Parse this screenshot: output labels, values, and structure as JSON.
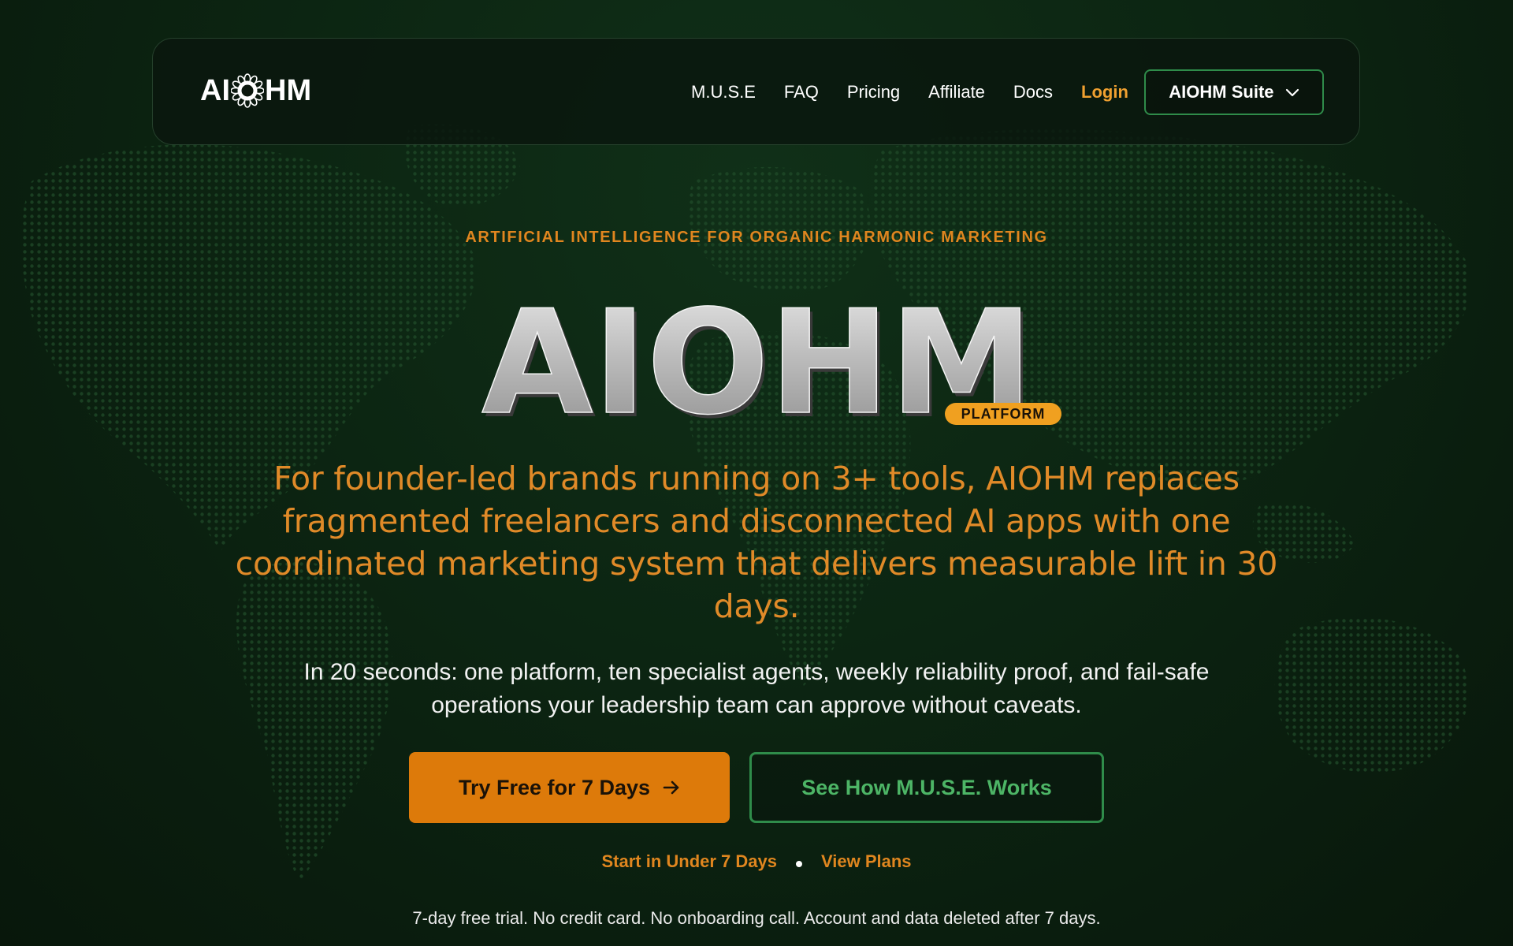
{
  "brand": {
    "logo_text_left": "AI",
    "logo_text_right": "HM"
  },
  "nav": {
    "items": [
      {
        "label": "M.U.S.E"
      },
      {
        "label": "FAQ"
      },
      {
        "label": "Pricing"
      },
      {
        "label": "Affiliate"
      },
      {
        "label": "Docs"
      }
    ],
    "login_label": "Login",
    "suite_label": "AIOHM Suite"
  },
  "hero": {
    "eyebrow": "ARTIFICIAL INTELLIGENCE FOR ORGANIC HARMONIC MARKETING",
    "title": "AIOHM",
    "badge": "PLATFORM",
    "headline": "For founder-led brands running on 3+ tools, AIOHM replaces fragmented freelancers and disconnected AI apps with one coordinated marketing system that delivers measurable lift in 30 days.",
    "subheadline": "In 20 seconds: one platform, ten specialist agents, weekly reliability proof, and fail-safe operations your leadership team can approve without caveats.",
    "cta_primary": "Try Free for 7 Days",
    "cta_secondary": "See How M.U.S.E. Works",
    "link_start": "Start in Under 7 Days",
    "link_plans": "View Plans",
    "disclaimer": "7-day free trial. No credit card. No onboarding call. Account and data deleted after 7 days."
  },
  "colors": {
    "accent_orange": "#dd7a0a",
    "accent_green": "#2f8c4a",
    "background": "#0c2512"
  },
  "icons": {
    "logo_mark": "flower-o-icon",
    "dropdown": "chevron-down-icon",
    "cta_arrow": "arrow-right-icon"
  }
}
